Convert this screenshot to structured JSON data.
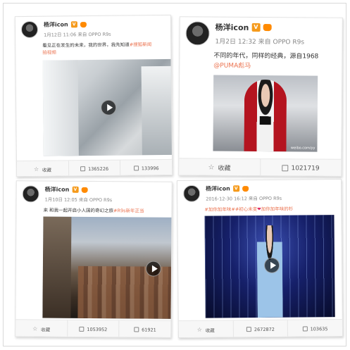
{
  "posts": [
    {
      "user": "杨洋icon",
      "time": "1月12日 11:06 来自 OPPO R9s",
      "text_line1": "看见正在发生的未来，我的世界，我先知道",
      "text_line1_tag": "#搜狐新闻",
      "text_line2": "拍视频",
      "favorite": "收藏",
      "repost": "1365226",
      "comment": "133996"
    },
    {
      "user": "杨洋icon",
      "time": "1月2日 12:32 来自 OPPO R9s",
      "text_line1": "不同的年代，同样的经典，源自1968",
      "mention": "@PUMA彪马",
      "watermark": "weibo.com/yy",
      "favorite": "收藏",
      "repost": "1021719"
    },
    {
      "user": "杨洋icon",
      "time": "1月10日 12:05 来自 OPPO R9s",
      "text_line1": "来 和我一起开启小人国的奇幻之旅",
      "text_line1_tag": "#R9s新年正当",
      "favorite": "收藏",
      "repost": "1053952",
      "comment": "61921"
    },
    {
      "user": "杨洋icon",
      "time": "2016-12-30 16:12 来自 OPPO R9s",
      "tag1": "#加你加年味#",
      "tag2": "#初心未变",
      "tag3": "加你加年味的杉",
      "favorite": "收藏",
      "repost": "2672872",
      "comment": "103635"
    }
  ],
  "colors": {
    "accent": "#eb7350",
    "verified": "#f59a1b"
  }
}
